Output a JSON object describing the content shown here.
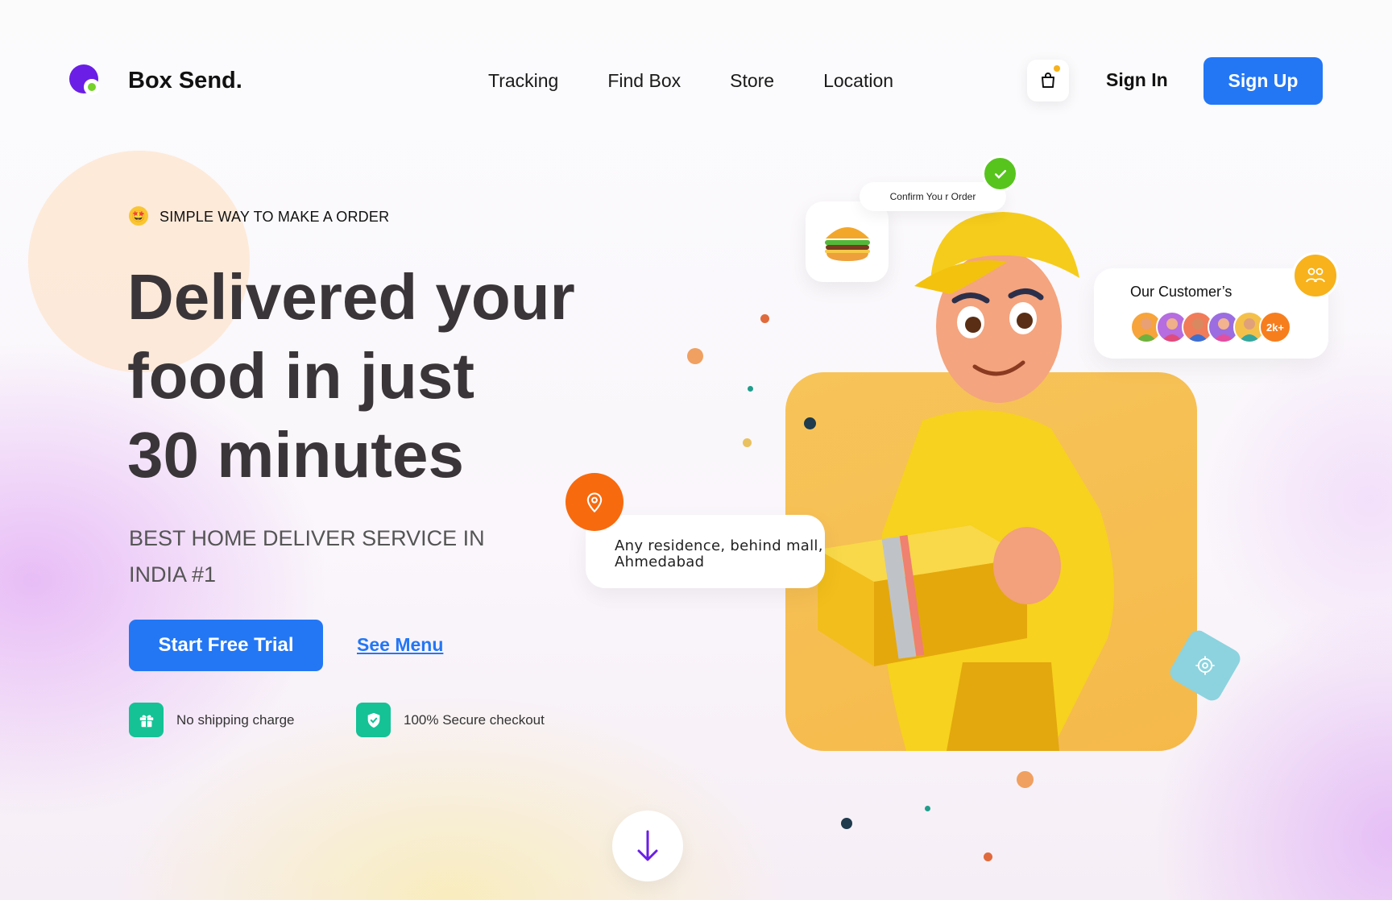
{
  "brand": {
    "name": "Box Send.",
    "logo_icon": "logo-circles-icon"
  },
  "nav": {
    "items": [
      {
        "label": "Tracking"
      },
      {
        "label": "Find Box"
      },
      {
        "label": "Store"
      },
      {
        "label": "Location"
      }
    ]
  },
  "header": {
    "cart_icon": "shopping-bag-icon",
    "sign_in": "Sign In",
    "sign_up": "Sign Up"
  },
  "hero": {
    "tagline": "SIMPLE WAY TO MAKE A ORDER",
    "tagline_icon": "star-struck-emoji-icon",
    "headline_lines": [
      "Delivered your",
      "food in just",
      "30 minutes"
    ],
    "subheading_lines": [
      "BEST HOME DELIVER SERVICE IN",
      "INDIA #1"
    ],
    "primary_cta": "Start Free Trial",
    "secondary_cta": "See Menu",
    "features": [
      {
        "icon": "gift-box-icon",
        "label": "No shipping charge"
      },
      {
        "icon": "shield-check-icon",
        "label": "100% Secure checkout"
      }
    ]
  },
  "illustration": {
    "confirm_label": "Confirm You r Order",
    "customers": {
      "title": "Our Customer’s",
      "more_label": "2k+"
    },
    "address": {
      "line1": "Any residence, behind mall,",
      "line2": "Ahmedabad"
    }
  },
  "colors": {
    "primary": "#2377f5",
    "accent_orange": "#f86a0e",
    "accent_yellow": "#f7b21c",
    "success": "#57c41e",
    "teal": "#14c296",
    "brand_purple": "#6a1ee6"
  }
}
